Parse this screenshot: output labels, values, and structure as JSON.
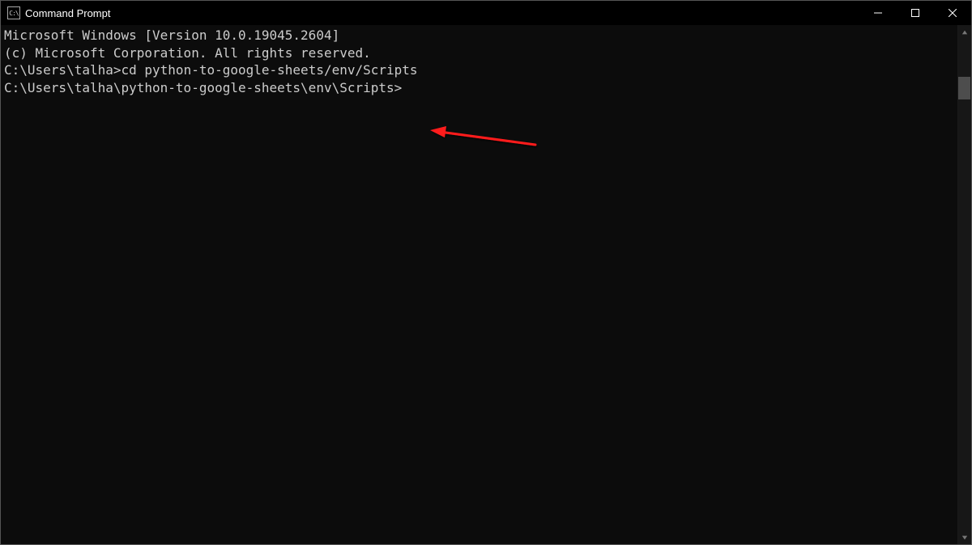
{
  "titlebar": {
    "icon_label": "cmd-icon",
    "title": "Command Prompt"
  },
  "window_controls": {
    "minimize": "minimize",
    "maximize": "maximize",
    "close": "close"
  },
  "terminal": {
    "lines": {
      "l0": "Microsoft Windows [Version 10.0.19045.2604]",
      "l1": "(c) Microsoft Corporation. All rights reserved.",
      "l2": "",
      "l3_prompt": "C:\\Users\\talha>",
      "l3_cmd": "cd python-to-google-sheets/env/Scripts",
      "l4": "",
      "l5_prompt": "C:\\Users\\talha\\python-to-google-sheets\\env\\Scripts>"
    }
  },
  "annotation": {
    "color": "#ff1a1a"
  }
}
